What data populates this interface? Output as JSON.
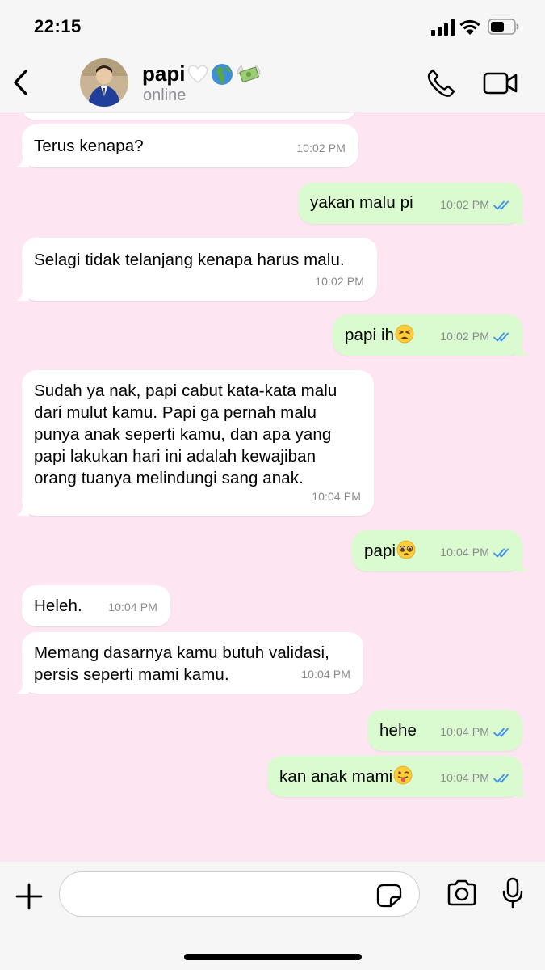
{
  "status_bar": {
    "time": "22:15"
  },
  "header": {
    "contact_name": "papi",
    "contact_emojis": [
      "white-heart",
      "globe-africa",
      "money-with-wings"
    ],
    "status": "online"
  },
  "colors": {
    "chat_background": "#fde6f1",
    "outgoing_bubble": "#dafbd0",
    "incoming_bubble": "#ffffff",
    "read_ticks": "#3c8ff2"
  },
  "messages": [
    {
      "dir": "in",
      "lines": [
        "Terus kenapa?"
      ],
      "time": "10:02 PM"
    },
    {
      "dir": "out",
      "lines": [
        "yakan malu pi"
      ],
      "time": "10:02 PM",
      "read": true
    },
    {
      "dir": "in",
      "lines": [
        "Selagi tidak telanjang kenapa harus malu."
      ],
      "time": "10:02 PM"
    },
    {
      "dir": "out",
      "lines": [
        "papi ih"
      ],
      "emoji": "tired-face",
      "time": "10:02 PM",
      "read": true
    },
    {
      "dir": "in",
      "lines": [
        "Sudah ya nak, papi cabut kata-kata malu",
        "dari mulut kamu. Papi ga pernah malu",
        "punya anak seperti kamu, dan apa yang",
        "papi lakukan hari ini adalah kewajiban",
        "orang tuanya melindungi sang anak."
      ],
      "time": "10:04 PM"
    },
    {
      "dir": "out",
      "lines": [
        "papi"
      ],
      "emoji": "pleading-face",
      "time": "10:04 PM",
      "read": true
    },
    {
      "dir": "in",
      "lines": [
        "Heleh."
      ],
      "time": "10:04 PM"
    },
    {
      "dir": "in",
      "lines": [
        "Memang dasarnya kamu butuh validasi,",
        "persis seperti mami kamu."
      ],
      "time": "10:04 PM"
    },
    {
      "dir": "out",
      "lines": [
        "hehe"
      ],
      "time": "10:04 PM",
      "read": true
    },
    {
      "dir": "out",
      "lines": [
        "kan anak mami"
      ],
      "emoji": "tongue-face",
      "time": "10:04 PM",
      "read": true
    }
  ],
  "composer": {
    "value": "",
    "placeholder": ""
  }
}
